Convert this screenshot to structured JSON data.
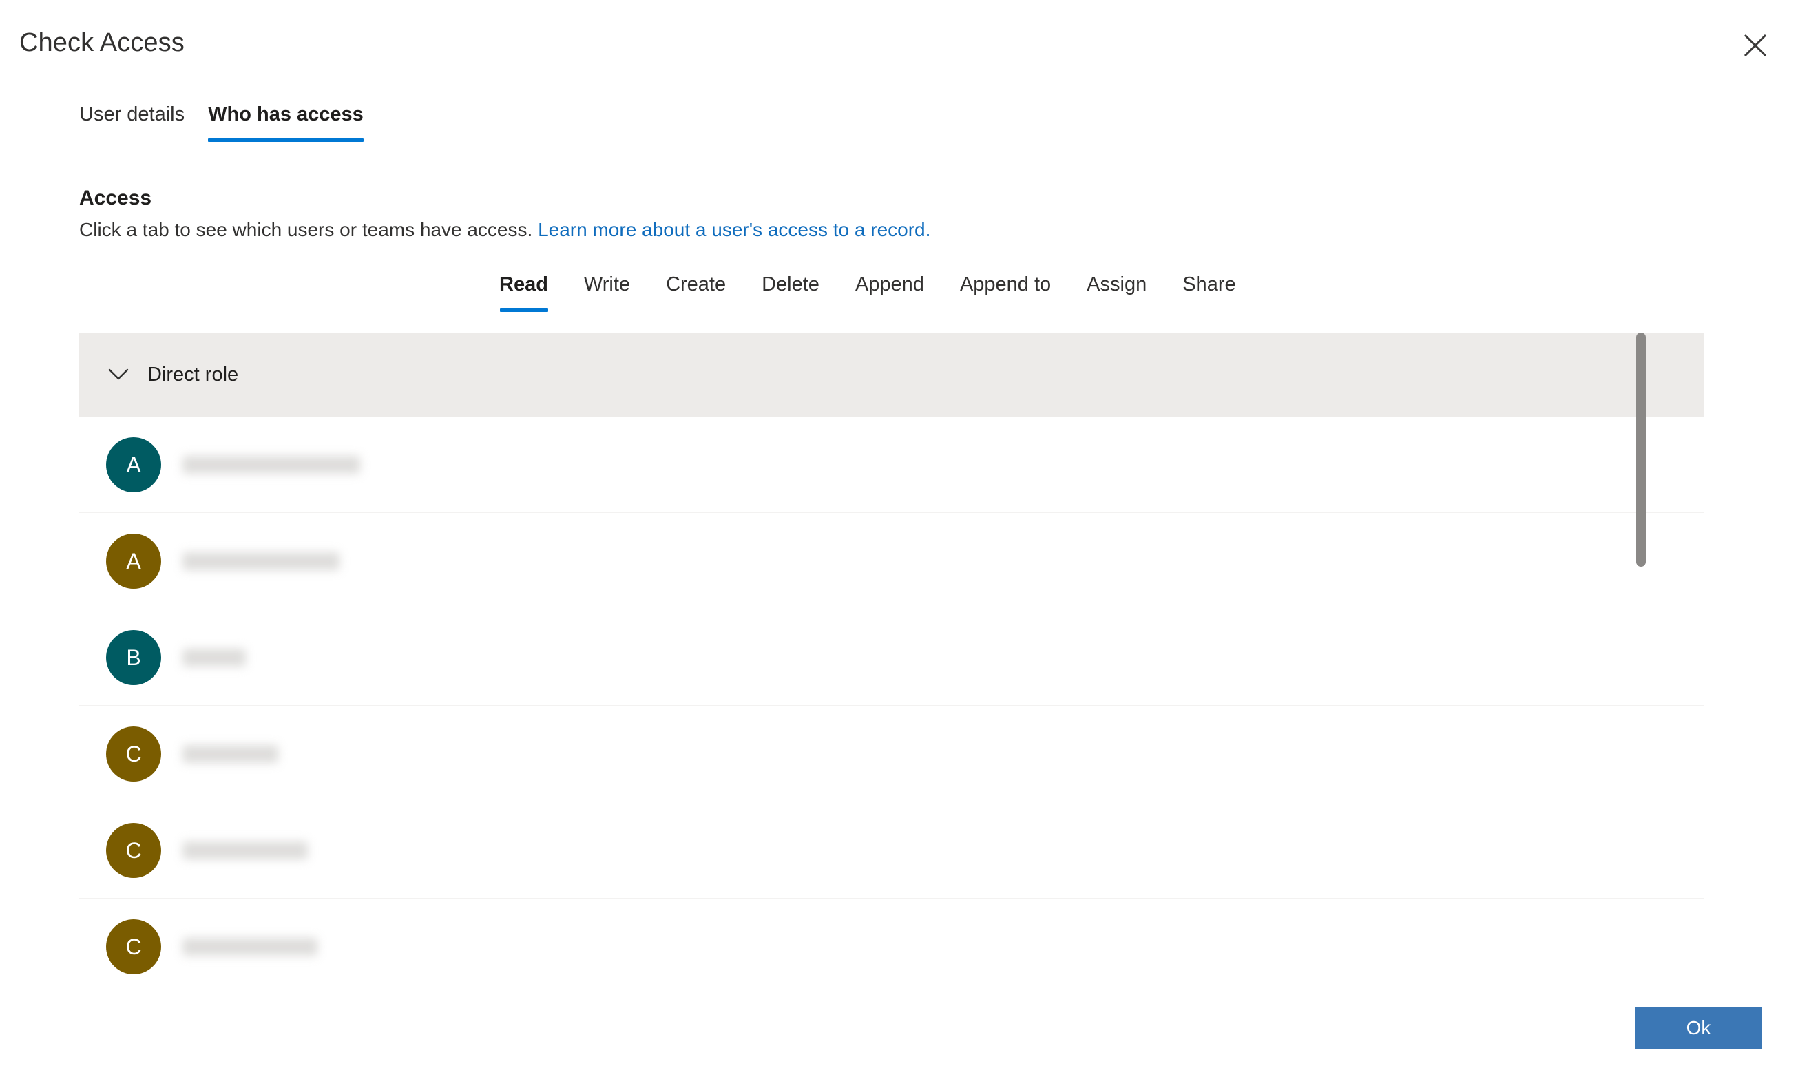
{
  "dialog": {
    "title": "Check Access",
    "close_icon": "close-icon"
  },
  "pivots": [
    {
      "label": "User details",
      "active": false
    },
    {
      "label": "Who has access",
      "active": true
    }
  ],
  "access_section": {
    "heading": "Access",
    "description": "Click a tab to see which users or teams have access.",
    "link_text": "Learn more about a user's access to a record.",
    "link_color": "#0f6cbd"
  },
  "permission_tabs": [
    {
      "label": "Read",
      "active": true
    },
    {
      "label": "Write",
      "active": false
    },
    {
      "label": "Create",
      "active": false
    },
    {
      "label": "Delete",
      "active": false
    },
    {
      "label": "Append",
      "active": false
    },
    {
      "label": "Append to",
      "active": false
    },
    {
      "label": "Assign",
      "active": false
    },
    {
      "label": "Share",
      "active": false
    }
  ],
  "group": {
    "title": "Direct role",
    "expanded": true,
    "chevron_icon": "chevron-down-icon",
    "header_background": "#edebe9"
  },
  "rows": [
    {
      "initial": "A",
      "avatar_color": "#005b62",
      "name": "",
      "name_width": 258
    },
    {
      "initial": "A",
      "avatar_color": "#7a5c00",
      "name": "",
      "name_width": 228
    },
    {
      "initial": "B",
      "avatar_color": "#005b62",
      "name": "",
      "name_width": 92
    },
    {
      "initial": "C",
      "avatar_color": "#7a5c00",
      "name": "",
      "name_width": 139
    },
    {
      "initial": "C",
      "avatar_color": "#7a5c00",
      "name": "",
      "name_width": 182
    },
    {
      "initial": "C",
      "avatar_color": "#7a5c00",
      "name": "",
      "name_width": 196
    }
  ],
  "scrollbar": {
    "thumb_color": "#8a8886",
    "position": "top"
  },
  "footer": {
    "ok_label": "Ok",
    "ok_color": "#3b77b5"
  },
  "accent_color": "#0078d4"
}
